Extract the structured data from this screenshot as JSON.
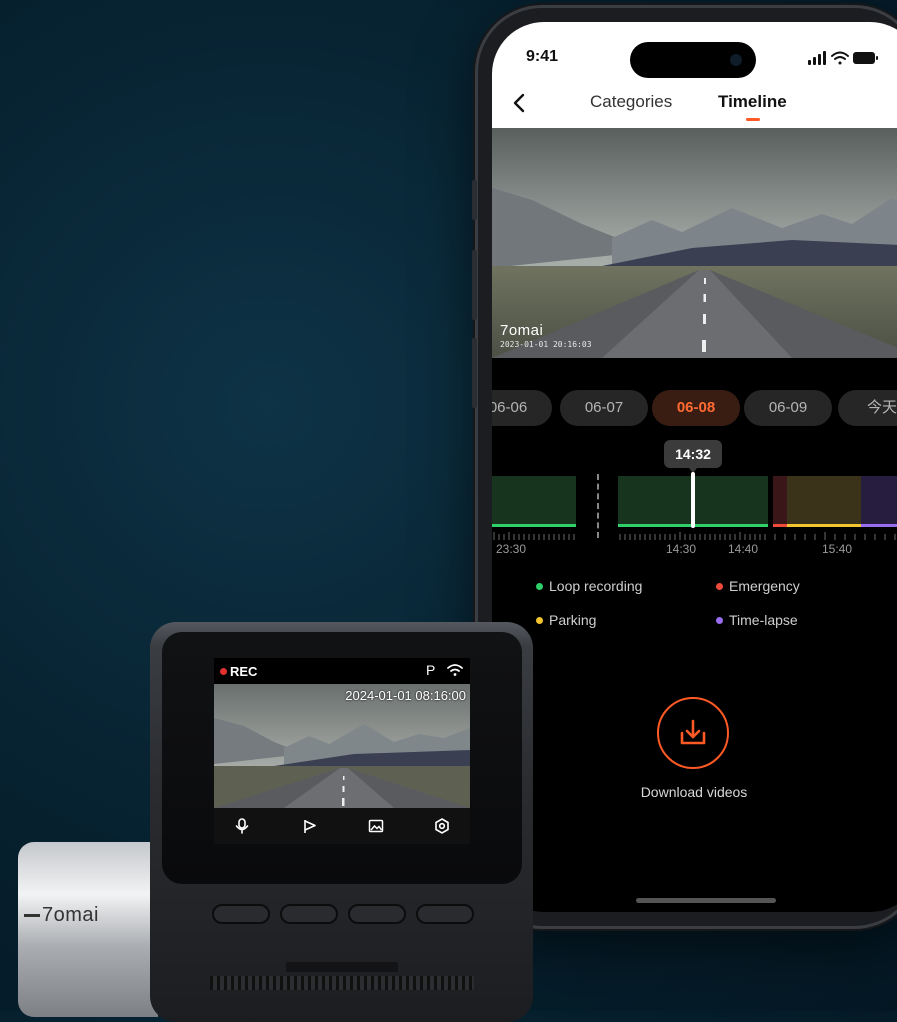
{
  "phone": {
    "status_time": "9:41",
    "nav": {
      "tab_categories": "Categories",
      "tab_timeline": "Timeline"
    },
    "video_watermark": {
      "logo": "7omai",
      "timestamp": "2023-01-01 20:16:03"
    },
    "dates": [
      "06-06",
      "06-07",
      "06-08",
      "06-09",
      "今天"
    ],
    "selected_date": "06-08",
    "cursor_time": "14:32",
    "time_labels": [
      "23:30",
      "14:30",
      "14:40",
      "15:40"
    ],
    "legend": [
      {
        "label": "Loop recording",
        "color": "#2fd06a"
      },
      {
        "label": "Emergency",
        "color": "#f04a3a"
      },
      {
        "label": "Parking",
        "color": "#f2c531"
      },
      {
        "label": "Time-lapse",
        "color": "#9a6cf0"
      }
    ],
    "download_label": "Download videos",
    "accent_color": "#ff5a26"
  },
  "dashcam": {
    "rec_label": "REC",
    "parking_indicator": "P",
    "timestamp": "2024-01-01 08:16:00",
    "brand": "7omai",
    "icons": [
      "microphone-icon",
      "flag-icon",
      "gallery-icon",
      "settings-icon"
    ]
  }
}
